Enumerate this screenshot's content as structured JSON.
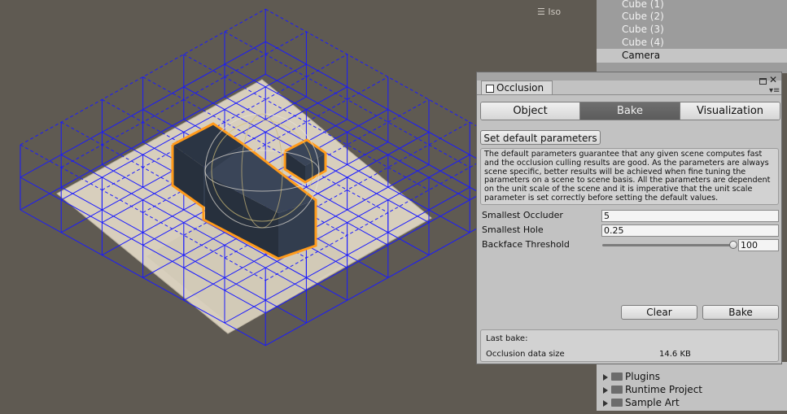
{
  "scene": {
    "view_mode_label": "Iso",
    "colors": {
      "background": "#5f5a52",
      "floor": "#d8cfbd",
      "grid": "#1a1aff",
      "occluder": "#27303d",
      "selection": "#ff9a1a"
    }
  },
  "hierarchy": {
    "items": [
      {
        "label": "Cube (1)"
      },
      {
        "label": "Cube (2)"
      },
      {
        "label": "Cube (3)"
      },
      {
        "label": "Cube (4)"
      },
      {
        "label": "Camera",
        "selected": true
      }
    ]
  },
  "occlusion": {
    "tab_label": "Occlusion",
    "modes": [
      {
        "label": "Object",
        "active": false
      },
      {
        "label": "Bake",
        "active": true
      },
      {
        "label": "Visualization",
        "active": false
      }
    ],
    "set_default_label": "Set default parameters",
    "info_text": "The default parameters guarantee that any given scene computes fast and the occlusion culling results are good. As the parameters are always scene specific, better results will be achieved when fine tuning the parameters on a scene to scene basis. All the parameters are dependent on the unit scale of the scene and it is imperative that the unit scale parameter is set correctly before setting the default values.",
    "fields": {
      "smallest_occluder": {
        "label": "Smallest Occluder",
        "value": "5"
      },
      "smallest_hole": {
        "label": "Smallest Hole",
        "value": "0.25"
      },
      "backface_threshold": {
        "label": "Backface Threshold",
        "value": "100",
        "slider_fraction": 1.0
      }
    },
    "clear_label": "Clear",
    "bake_label": "Bake",
    "last_bake_label": "Last bake:",
    "data_size_label": "Occlusion data size",
    "data_size_value": "14.6 KB"
  },
  "project": {
    "items": [
      {
        "label": "Plugins"
      },
      {
        "label": "Runtime Project"
      },
      {
        "label": "Sample Art"
      }
    ]
  }
}
